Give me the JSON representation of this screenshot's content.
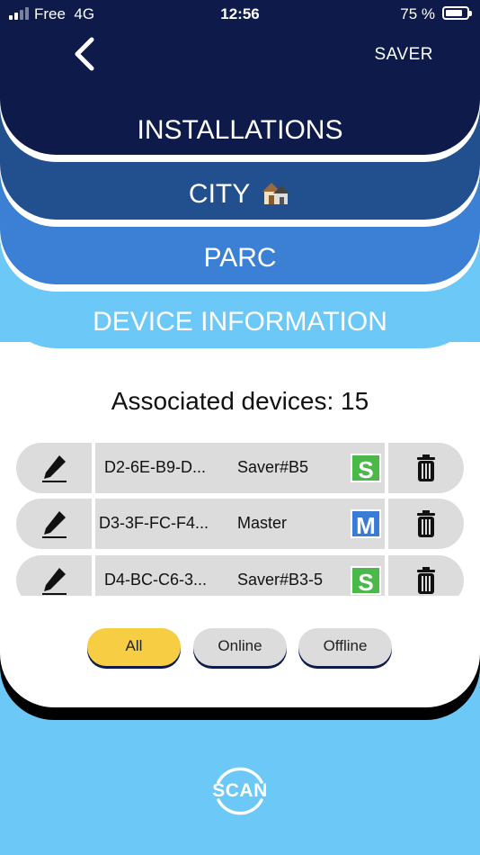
{
  "status_bar": {
    "carrier": "Free",
    "network": "4G",
    "time": "12:56",
    "battery": "75 %"
  },
  "header": {
    "back_icon": "chevron-left-icon",
    "action_label": "SAVER"
  },
  "nav_cards": {
    "installations": "INSTALLATIONS",
    "city": "CITY",
    "parc": "PARC",
    "device_information": "DEVICE INFORMATION"
  },
  "associated_devices": "Associated devices: 15",
  "devices": [
    {
      "mac": "D2-6E-B9-D...",
      "role": "Saver#B5",
      "badge": "S",
      "badge_color": "#4bb949"
    },
    {
      "mac": "D3-3F-FC-F4...",
      "role": "Master",
      "badge": "M",
      "badge_color": "#3a7cd5"
    },
    {
      "mac": "D4-BC-C6-3...",
      "role": "Saver#B3-5",
      "badge": "S",
      "badge_color": "#4bb949"
    }
  ],
  "filters": {
    "all": "All",
    "online": "Online",
    "offline": "Offline",
    "selected": "All"
  },
  "scan_label": "SCAN",
  "colors": {
    "navy": "#0d1a4a",
    "blue_dark": "#22508f",
    "blue_mid": "#3b80d4",
    "blue_light": "#6cc8f7",
    "accent_yellow": "#f6cd43"
  }
}
